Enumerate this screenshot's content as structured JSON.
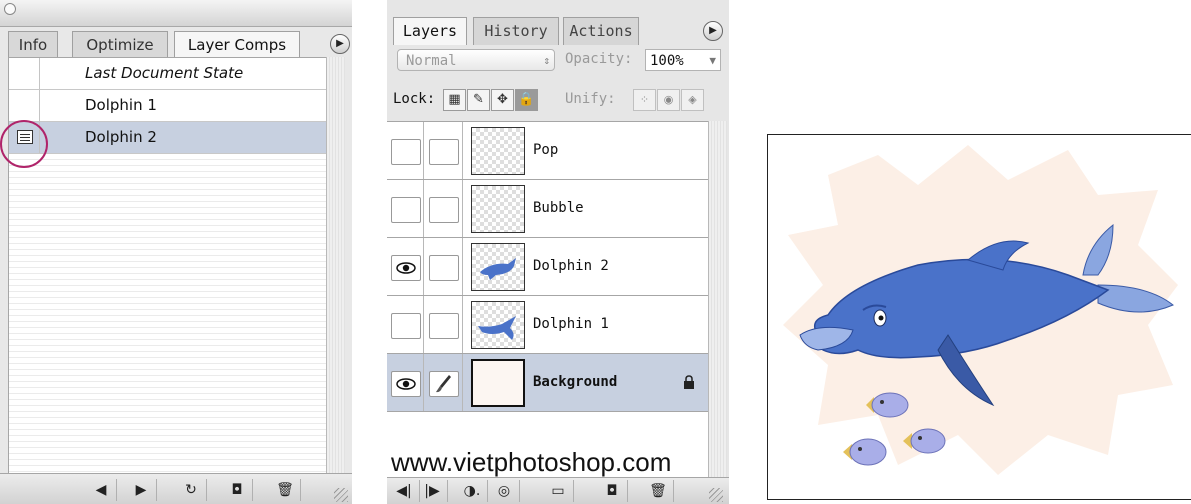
{
  "layer_comps_panel": {
    "tabs": [
      {
        "label": "Info",
        "active": false
      },
      {
        "label": "Optimize",
        "active": false
      },
      {
        "label": "Layer Comps",
        "active": true
      }
    ],
    "comps": [
      {
        "label": "Last Document State",
        "italic": true,
        "selected": false,
        "has_icon": false
      },
      {
        "label": "Dolphin 1",
        "italic": false,
        "selected": false,
        "has_icon": false
      },
      {
        "label": "Dolphin 2",
        "italic": false,
        "selected": true,
        "has_icon": true
      }
    ],
    "footer_buttons": [
      "previous-comp",
      "next-comp",
      "update-comp",
      "new-comp",
      "delete-comp"
    ]
  },
  "layers_panel": {
    "tabs": [
      {
        "label": "Layers",
        "active": true
      },
      {
        "label": "History",
        "active": false
      },
      {
        "label": "Actions",
        "active": false
      }
    ],
    "blend_mode": "Normal",
    "opacity_label": "Opacity:",
    "opacity_value": "100%",
    "lock_label": "Lock:",
    "unify_label": "Unify:",
    "layers": [
      {
        "name": "Pop",
        "visible": false,
        "brush": false,
        "selected": false,
        "locked": false,
        "thumb": "transparent"
      },
      {
        "name": "Bubble",
        "visible": false,
        "brush": false,
        "selected": false,
        "locked": false,
        "thumb": "transparent"
      },
      {
        "name": "Dolphin 2",
        "visible": true,
        "brush": false,
        "selected": false,
        "locked": false,
        "thumb": "dolphin2"
      },
      {
        "name": "Dolphin 1",
        "visible": false,
        "brush": false,
        "selected": false,
        "locked": false,
        "thumb": "dolphin1"
      },
      {
        "name": "Background",
        "visible": true,
        "brush": true,
        "selected": true,
        "locked": true,
        "thumb": "background"
      }
    ],
    "watermark": "www.vietphotoshop.com",
    "footer_buttons": [
      "link-icon",
      "layer-style-icon",
      "mask-icon",
      "new-group-icon",
      "new-layer-icon",
      "trash-icon"
    ]
  },
  "colors": {
    "selection": "#c7d0e0",
    "dolphin": "#4a72c9",
    "highlight_circle": "#b0246a"
  }
}
